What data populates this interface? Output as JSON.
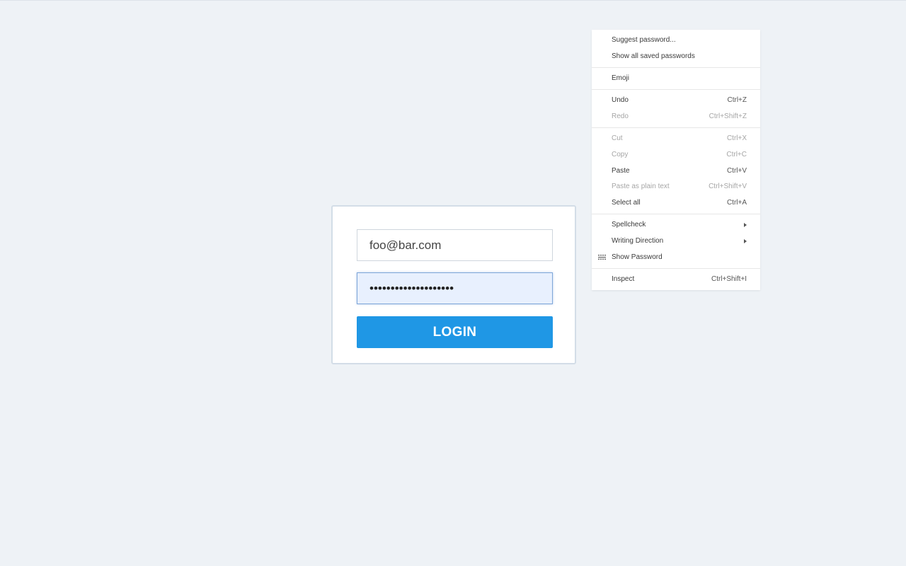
{
  "login_form": {
    "email_value": "foo@bar.com",
    "password_value": "••••••••••••••••••••",
    "login_label": "LOGIN"
  },
  "context_menu": {
    "suggest_password": "Suggest password...",
    "show_saved_passwords": "Show all saved passwords",
    "emoji": "Emoji",
    "undo": {
      "label": "Undo",
      "shortcut": "Ctrl+Z"
    },
    "redo": {
      "label": "Redo",
      "shortcut": "Ctrl+Shift+Z"
    },
    "cut": {
      "label": "Cut",
      "shortcut": "Ctrl+X"
    },
    "copy": {
      "label": "Copy",
      "shortcut": "Ctrl+C"
    },
    "paste": {
      "label": "Paste",
      "shortcut": "Ctrl+V"
    },
    "paste_plain": {
      "label": "Paste as plain text",
      "shortcut": "Ctrl+Shift+V"
    },
    "select_all": {
      "label": "Select all",
      "shortcut": "Ctrl+A"
    },
    "spellcheck": "Spellcheck",
    "writing_direction": "Writing Direction",
    "show_password": "Show Password",
    "inspect": {
      "label": "Inspect",
      "shortcut": "Ctrl+Shift+I"
    }
  },
  "colors": {
    "page_background": "#eef2f6",
    "button_background": "#1f97e5",
    "autofill_background": "#e8f0fe"
  },
  "icons": {
    "show_password": "eye-icon",
    "submenu": "chevron-right-icon"
  }
}
